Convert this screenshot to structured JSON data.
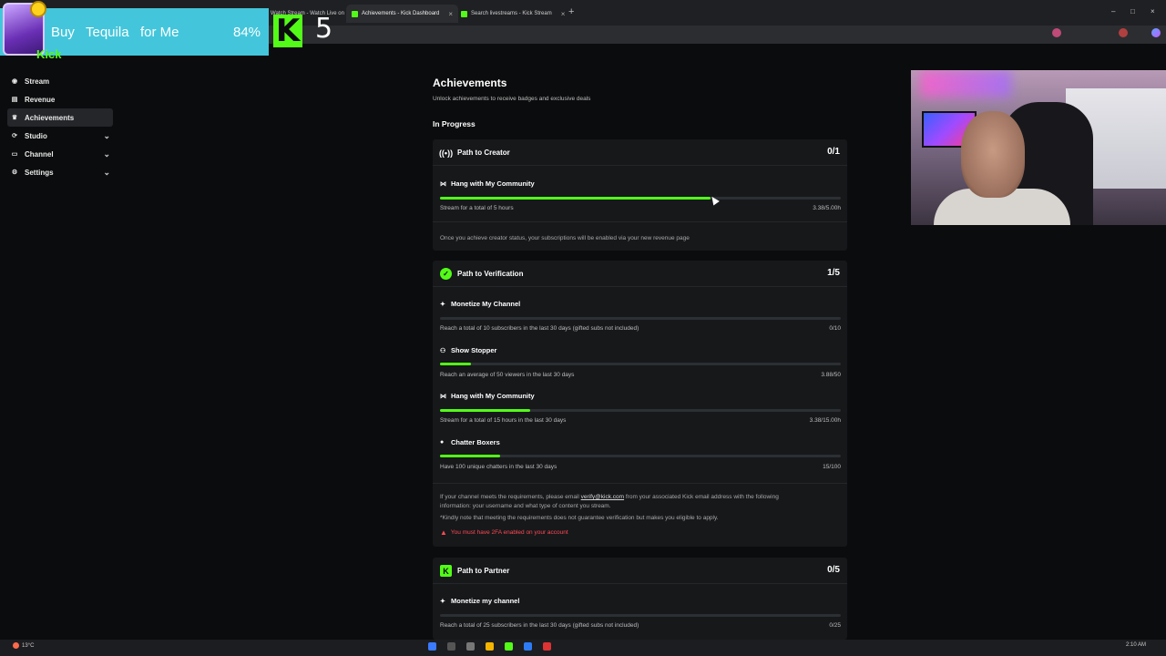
{
  "browser": {
    "tabs": [
      {
        "label": "Watch Stream - Watch Live on",
        "active": false
      },
      {
        "label": "Achievements - Kick Dashboard",
        "active": true
      },
      {
        "label": "Search livestreams - Kick Stream",
        "active": false
      }
    ],
    "new_tab": "+"
  },
  "overlay": {
    "donation_label_1": "Buy",
    "donation_label_2": "Tequila",
    "donation_label_3": "for Me",
    "donation_percent": "84%",
    "kick_logo_letter": "K",
    "kick_number": "5",
    "logo_word": "Kick"
  },
  "sidebar": {
    "items": [
      {
        "label": "Stream",
        "icon": "stream-icon",
        "active": false
      },
      {
        "label": "Revenue",
        "icon": "revenue-icon",
        "active": false
      },
      {
        "label": "Achievements",
        "icon": "trophy-icon",
        "active": true
      },
      {
        "label": "Studio",
        "icon": "studio-icon",
        "active": false,
        "expandable": true
      },
      {
        "label": "Channel",
        "icon": "channel-icon",
        "active": false,
        "expandable": true
      },
      {
        "label": "Settings",
        "icon": "settings-icon",
        "active": false,
        "expandable": true
      }
    ]
  },
  "main": {
    "title": "Achievements",
    "subtitle": "Unlock achievements to receive badges and exclusive deals",
    "section": "In Progress",
    "cards": [
      {
        "title": "Path to Creator",
        "score": "0/1",
        "goals": [
          {
            "title": "Hang with My Community",
            "desc": "Stream for a total of 5 hours",
            "value": "3.38/5.00h",
            "progress": 0.676
          }
        ],
        "note": "Once you achieve creator status, your subscriptions will be enabled via your new revenue page"
      },
      {
        "title": "Path to Verification",
        "score": "1/5",
        "goals": [
          {
            "title": "Monetize My Channel",
            "desc": "Reach a total of 10 subscribers in the last 30 days (gifted subs not included)",
            "value": "0/10",
            "progress": 0.0
          },
          {
            "title": "Show Stopper",
            "desc": "Reach an average of 50 viewers in the last 30 days",
            "value": "3.88/50",
            "progress": 0.078
          },
          {
            "title": "Hang with My Community",
            "desc": "Stream for a total of 15 hours in the last 30 days",
            "value": "3.38/15.00h",
            "progress": 0.225
          },
          {
            "title": "Chatter Boxers",
            "desc": "Have 100 unique chatters in the last 30 days",
            "value": "15/100",
            "progress": 0.15
          }
        ],
        "note_pre": "If your channel meets the requirements, please email ",
        "note_email": "verify@kick.com",
        "note_post": " from your associated Kick email address with the following",
        "note_line2": "information: your username and what type of content you stream.",
        "note_line3": "*Kindly note that meeting the requirements does not guarantee verification but makes you eligible to apply.",
        "warning": "You must have 2FA enabled on your account"
      },
      {
        "title": "Path to Partner",
        "score": "0/5",
        "goals": [
          {
            "title": "Monetize my channel",
            "desc": "Reach a total of 25 subscribers in the last 30 days (gifted subs not included)",
            "value": "0/25",
            "progress": 0.0
          }
        ]
      }
    ]
  },
  "taskbar": {
    "weather": "13°C",
    "time": "2:10 AM"
  },
  "colors": {
    "accent": "#53fc18",
    "background": "#0b0c0d",
    "card": "#16181a",
    "warning": "#ff4a55",
    "overlay_bg": "#43c6db"
  }
}
